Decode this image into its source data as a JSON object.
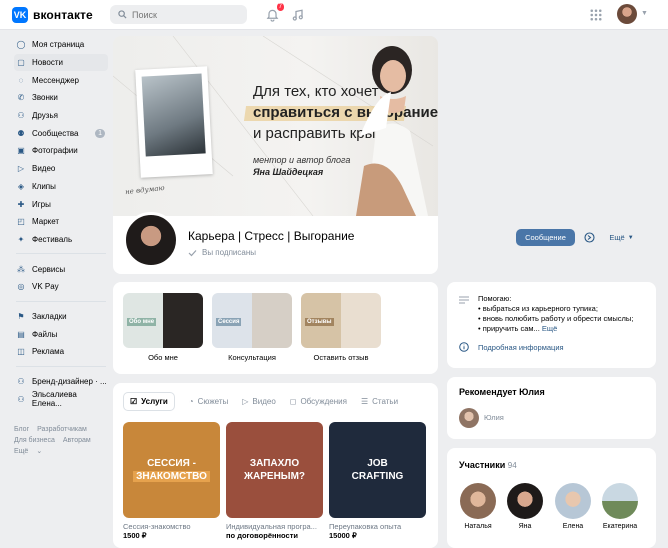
{
  "header": {
    "logo_text": "вконтакте",
    "search_placeholder": "Поиск",
    "notification_count": "7"
  },
  "sidebar": {
    "items": [
      {
        "label": "Моя страница"
      },
      {
        "label": "Новости"
      },
      {
        "label": "Мессенджер"
      },
      {
        "label": "Звонки"
      },
      {
        "label": "Друзья"
      },
      {
        "label": "Сообщества",
        "count": "1"
      },
      {
        "label": "Фотографии"
      },
      {
        "label": "Видео"
      },
      {
        "label": "Клипы"
      },
      {
        "label": "Игры"
      },
      {
        "label": "Маркет"
      },
      {
        "label": "Фестиваль"
      }
    ],
    "items2": [
      {
        "label": "Сервисы"
      },
      {
        "label": "VK Pay"
      }
    ],
    "items3": [
      {
        "label": "Закладки"
      },
      {
        "label": "Файлы"
      },
      {
        "label": "Реклама"
      }
    ],
    "items4": [
      {
        "label": "Бренд-дизайнер · ..."
      },
      {
        "label": "Эльсалиева Елена..."
      }
    ],
    "footer": {
      "line1": [
        "Блог",
        "Разработчикам"
      ],
      "line2": [
        "Для бизнеса",
        "Авторам"
      ],
      "line3": [
        "Ещё"
      ]
    }
  },
  "cover": {
    "line1": "Для тех, кто хочет",
    "line2": "справиться с выгоранием",
    "line3": "и расправить крылья",
    "sub1": "ментор и автор блога",
    "sub2": "Яна Шайдецкая",
    "polaroid_caption": "не вдумаю"
  },
  "profile": {
    "name": "Карьера | Стресс | Выгорание",
    "subscribed": "Вы подписаны",
    "message_button": "Сообщение",
    "more_button": "Ещё"
  },
  "tiles": [
    {
      "label": "Обо мне",
      "caption": "Обо мне",
      "color": "#8fb3a6"
    },
    {
      "label": "Сессия",
      "caption": "Консультация",
      "color": "#8aa3b5"
    },
    {
      "label": "Отзывы",
      "caption": "Оставить отзыв",
      "color": "#a2845f"
    }
  ],
  "info": {
    "title": "Помогаю:",
    "lines": [
      "• выбраться из карьерного тупика;",
      "• вновь полюбить работу и обрести смыслы;",
      "• приручить сам..."
    ],
    "more": "Ещё",
    "detail_link": "Подробная информация"
  },
  "tabs": [
    {
      "label": "Услуги"
    },
    {
      "label": "Сюжеты"
    },
    {
      "label": "Видео"
    },
    {
      "label": "Обсуждения"
    },
    {
      "label": "Статьи"
    }
  ],
  "services": [
    {
      "text1": "СЕССИЯ -",
      "text2": "ЗНАКОМСТВО",
      "caption": "Сессия-знакомство",
      "price": "1500 ₽",
      "color": "#c8873a"
    },
    {
      "text1": "ЗАПАХЛО",
      "text2": "ЖАРЕНЫМ?",
      "caption": "Индивидуальная програ...",
      "price": "по договорённости",
      "color": "#9a4f3d"
    },
    {
      "text1": "JOB",
      "text2": "CRAFTING",
      "caption": "Переупаковка опыта",
      "price": "15000 ₽",
      "color": "#1f2a3c"
    }
  ],
  "recommends": {
    "title": "Рекомендует Юлия",
    "name": "Юлия"
  },
  "members": {
    "title": "Участники",
    "count": "94",
    "people": [
      {
        "name": "Наталья"
      },
      {
        "name": "Яна"
      },
      {
        "name": "Елена"
      },
      {
        "name": "Екатерина"
      }
    ]
  },
  "colors": {
    "accent": "#4a76a8",
    "link": "#2a5885",
    "brand": "#0077ff"
  }
}
